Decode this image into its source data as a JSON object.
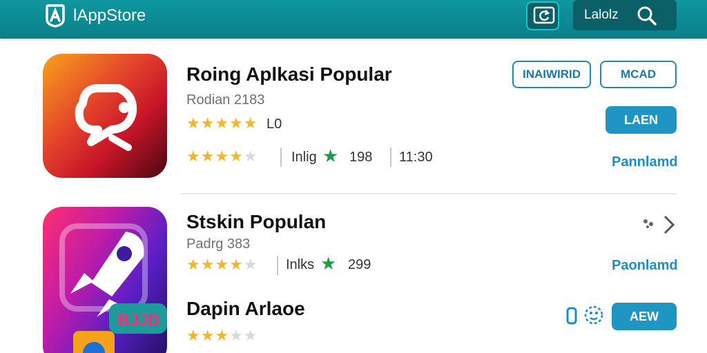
{
  "header": {
    "brand": "lAppStore",
    "search_label": "Lalolz",
    "colors": {
      "bar": "#0b8d96",
      "panel": "#0b5f66"
    }
  },
  "apps": [
    {
      "title": "Roing Aplkasi Popular",
      "subtitle": "Rodian 2183",
      "rating_count": "L0",
      "detail_stars_label": "4.5",
      "detail_label": "Inlig",
      "downloads": "198",
      "size": "11:30",
      "buttons": {
        "outline_1": "INAIWIRID",
        "outline_2": "MCAD",
        "primary": "LAEN"
      },
      "link": "Pannlamd"
    },
    {
      "title": "Stskin Populan",
      "subtitle": "Padrg 383",
      "detail_label": "Inlks",
      "downloads": "299",
      "link": "Paonlamd"
    },
    {
      "title": "Dapin Arlaoe",
      "buttons": {
        "primary": "AEW"
      }
    }
  ],
  "icons": {
    "logo": "app-store-logo-icon",
    "refresh": "refresh-icon",
    "search": "search-icon",
    "more": "more-dots-icon",
    "chevron": "chevron-right-icon",
    "share": "share-icon",
    "emoji": "emoji-icon"
  },
  "badge_text": "BJJD",
  "accent": "#1e95c3"
}
